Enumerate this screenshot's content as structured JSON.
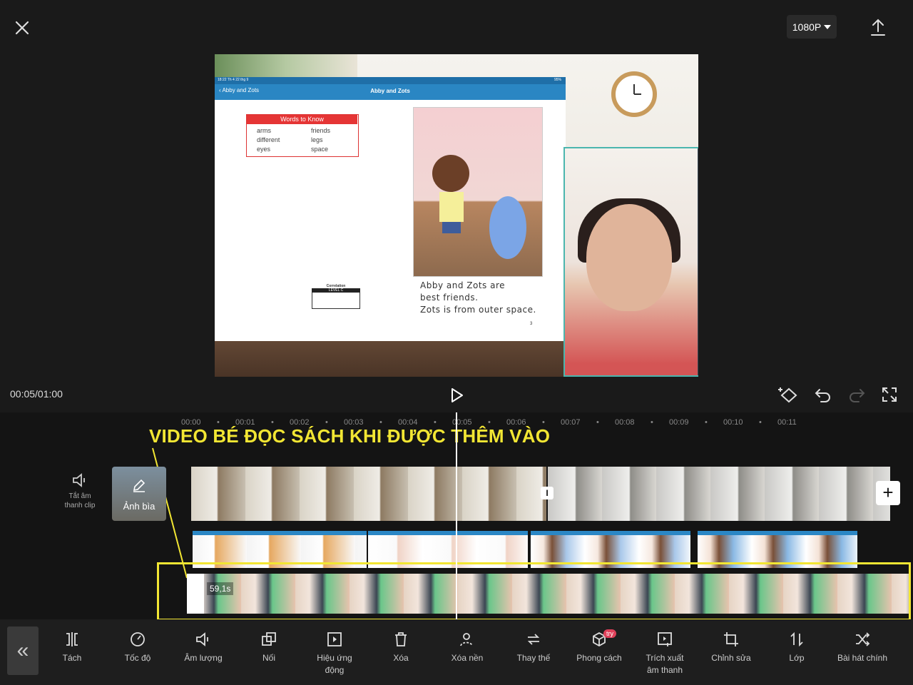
{
  "top_bar": {
    "resolution": "1080P",
    "close_icon": "close-icon",
    "export_icon": "upload-icon"
  },
  "preview": {
    "tablet_status": "18:22  Th 4 22 thg 9",
    "tablet_battery": "95%",
    "tablet_back": "Abby and Zots",
    "tablet_title": "Abby and Zots",
    "words_title": "Words to Know",
    "words_col1": [
      "arms",
      "different",
      "eyes"
    ],
    "words_col2": [
      "friends",
      "legs",
      "space"
    ],
    "correlation_title": "Correlation",
    "correlation_level": "LEVEL C",
    "book_text_1": "Abby and Zots are",
    "book_text_2": "best friends.",
    "book_text_3": "Zots is from outer space.",
    "page_number": "3"
  },
  "transport": {
    "time": "00:05/01:00"
  },
  "timeline": {
    "ruler_ticks": [
      "00:00",
      "00:01",
      "00:02",
      "00:03",
      "00:04",
      "00:05",
      "00:06",
      "00:07",
      "00:08",
      "00:09",
      "00:10",
      "00:11"
    ],
    "annotation": "VIDEO BÉ ĐỌC SÁCH KHI ĐƯỢC THÊM VÀO",
    "mute_label_1": "Tắt âm",
    "mute_label_2": "thanh clip",
    "cover_label": "Ảnh bìa",
    "webcam_duration": "59,1s",
    "highlight_color": "#f2e633"
  },
  "toolbar": {
    "items": [
      {
        "label": "Tách",
        "icon": "split-icon"
      },
      {
        "label": "Tốc độ",
        "icon": "speed-icon"
      },
      {
        "label": "Âm lượng",
        "icon": "volume-icon"
      },
      {
        "label": "Nối",
        "icon": "overlay-icon"
      },
      {
        "label": "Hiệu ứng",
        "label2": "động",
        "icon": "animation-icon"
      },
      {
        "label": "Xóa",
        "icon": "delete-icon"
      },
      {
        "label": "Xóa nền",
        "icon": "remove-bg-icon"
      },
      {
        "label": "Thay thế",
        "icon": "replace-icon"
      },
      {
        "label": "Phong cách",
        "icon": "style-icon",
        "badge": "try"
      },
      {
        "label": "Trích xuất",
        "label2": "âm thanh",
        "icon": "extract-audio-icon"
      },
      {
        "label": "Chỉnh sửa",
        "icon": "crop-icon"
      },
      {
        "label": "Lớp",
        "icon": "layer-icon"
      },
      {
        "label": "Bài hát chính",
        "icon": "shuffle-icon"
      }
    ]
  }
}
